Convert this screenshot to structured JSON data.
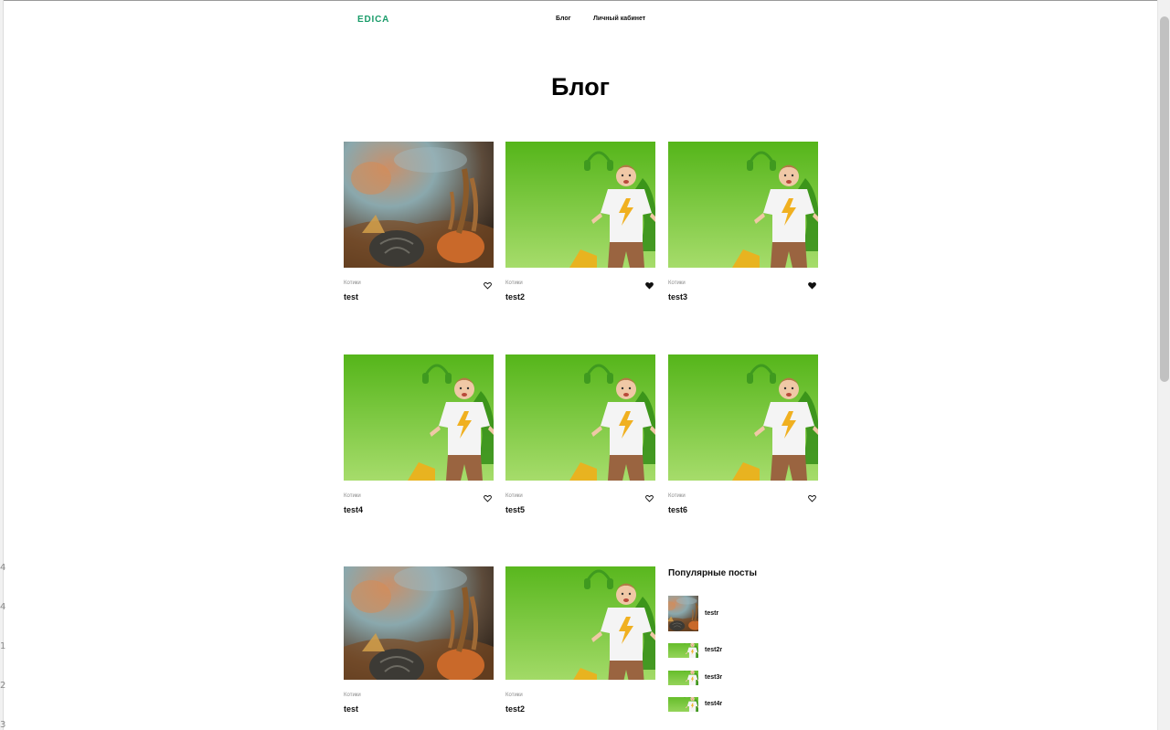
{
  "brand": {
    "logo": "EDICA",
    "accent_color": "#1a9c6a"
  },
  "nav": {
    "items": [
      {
        "label": "Блог"
      },
      {
        "label": "Личный кабинет"
      }
    ]
  },
  "page": {
    "title": "Блог"
  },
  "posts": [
    {
      "category": "Котики",
      "title": "test",
      "image": "autumn-pumpkin-photo",
      "liked": false
    },
    {
      "category": "Котики",
      "title": "test2",
      "image": "kid-on-green-photo",
      "liked": true
    },
    {
      "category": "Котики",
      "title": "test3",
      "image": "kid-on-green-photo",
      "liked": true
    },
    {
      "category": "Котики",
      "title": "test4",
      "image": "kid-on-green-photo",
      "liked": false
    },
    {
      "category": "Котики",
      "title": "test5",
      "image": "kid-on-green-photo",
      "liked": false
    },
    {
      "category": "Котики",
      "title": "test6",
      "image": "kid-on-green-photo",
      "liked": false
    },
    {
      "category": "Котики",
      "title": "test",
      "image": "autumn-pumpkin-photo"
    },
    {
      "category": "Котики",
      "title": "test2",
      "image": "kid-on-green-photo"
    }
  ],
  "popular": {
    "heading": "Популярные посты",
    "items": [
      {
        "title": "testr",
        "image": "autumn-pumpkin-photo"
      },
      {
        "title": "test2r",
        "image": "kid-on-green-photo"
      },
      {
        "title": "test3r",
        "image": "kid-on-green-photo"
      },
      {
        "title": "test4r",
        "image": "kid-on-green-photo"
      }
    ]
  },
  "icons": {
    "like": "heart-icon"
  },
  "window": {
    "left_edge_marks": [
      "4",
      "4",
      "1",
      "2",
      "3"
    ]
  }
}
